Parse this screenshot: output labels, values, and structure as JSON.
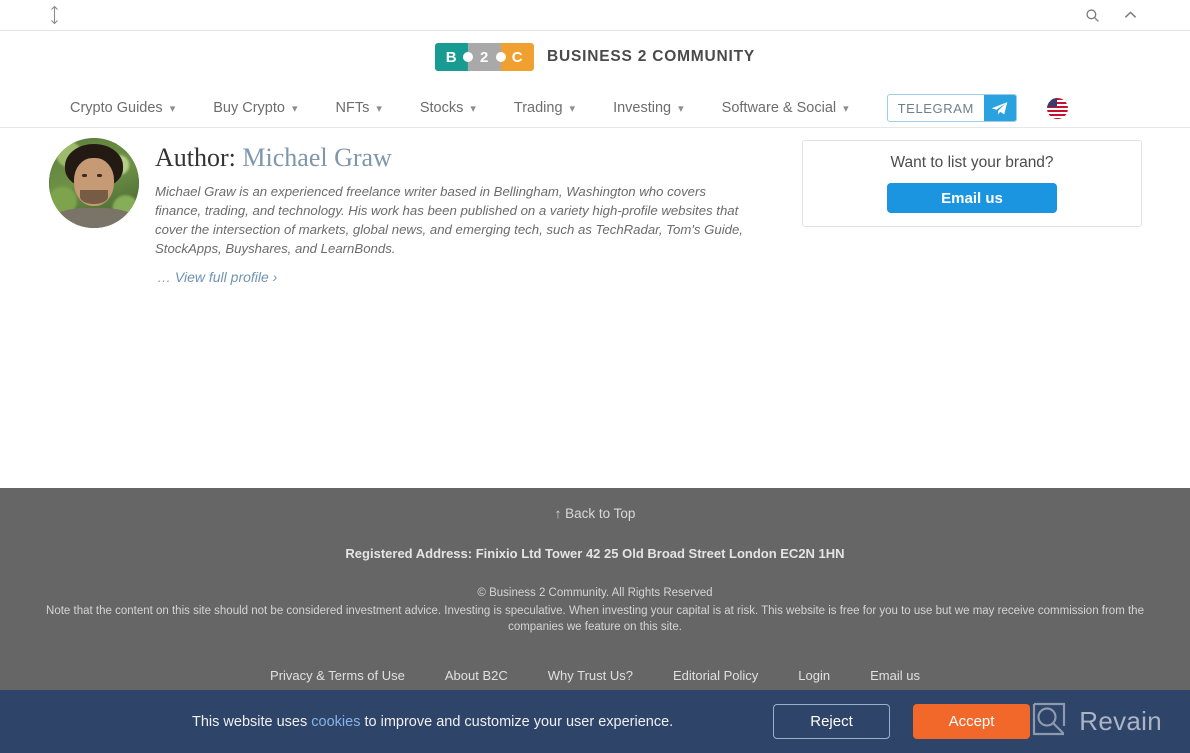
{
  "browser": {
    "resize_cursor_icon": "vertical-resize-cursor",
    "search_icon": "search-icon",
    "collapse_icon": "chevron-up-icon"
  },
  "header": {
    "logo": {
      "piece1": "B",
      "piece2": "2",
      "piece3": "C"
    },
    "brand_name": "BUSINESS 2 COMMUNITY",
    "colors": {
      "teal": "#179b93",
      "gray": "#a9a9a9",
      "orange": "#f0a02e"
    }
  },
  "nav": {
    "items": [
      {
        "label": "Crypto Guides",
        "has_dropdown": true
      },
      {
        "label": "Buy Crypto",
        "has_dropdown": true
      },
      {
        "label": "NFTs",
        "has_dropdown": true
      },
      {
        "label": "Stocks",
        "has_dropdown": true
      },
      {
        "label": "Trading",
        "has_dropdown": true
      },
      {
        "label": "Investing",
        "has_dropdown": true
      },
      {
        "label": "Software & Social",
        "has_dropdown": true
      }
    ],
    "telegram_label": "TELEGRAM",
    "telegram_icon": "telegram-paper-plane-icon",
    "flag_icon": "us-flag-icon"
  },
  "author": {
    "title_prefix": "Author:",
    "name": "Michael Graw",
    "avatar_icon": "author-portrait",
    "bio": "Michael Graw is an experienced freelance writer based in Bellingham, Washington who covers finance, trading, and technology. His work has been published on a variety high-profile websites that cover the intersection of markets, global news, and emerging tech, such as TechRadar, Tom's Guide, StockApps, Buyshares, and LearnBonds.",
    "ellipsis": "…",
    "profile_link": "View full profile ›"
  },
  "brand_card": {
    "title": "Want to list your brand?",
    "button_label": "Email us",
    "button_color": "#1b95e0"
  },
  "footer": {
    "back_to_top": "↑ Back to Top",
    "registered_address": "Registered Address: Finixio Ltd Tower 42 25 Old Broad Street London EC2N 1HN",
    "copyright": "© Business 2 Community.  All Rights Reserved",
    "disclaimer": "Note that the content on this site should not be considered investment advice. Investing is speculative. When investing your capital is at risk. This website is free for you to use but we may receive commission from the companies we feature on this site.",
    "links": [
      "Privacy & Terms of Use",
      "About B2C",
      "Why Trust Us?",
      "Editorial Policy",
      "Login",
      "Email us"
    ],
    "background_color": "#666666"
  },
  "cookie_banner": {
    "text_before": "This website uses ",
    "link": "cookies",
    "text_after": " to improve and customize your user experience.",
    "reject_label": "Reject",
    "accept_label": "Accept",
    "accept_color": "#f2672a",
    "background_color": "#2e4468",
    "watermark_label": "Revain",
    "watermark_icon": "revain-logo-icon"
  }
}
